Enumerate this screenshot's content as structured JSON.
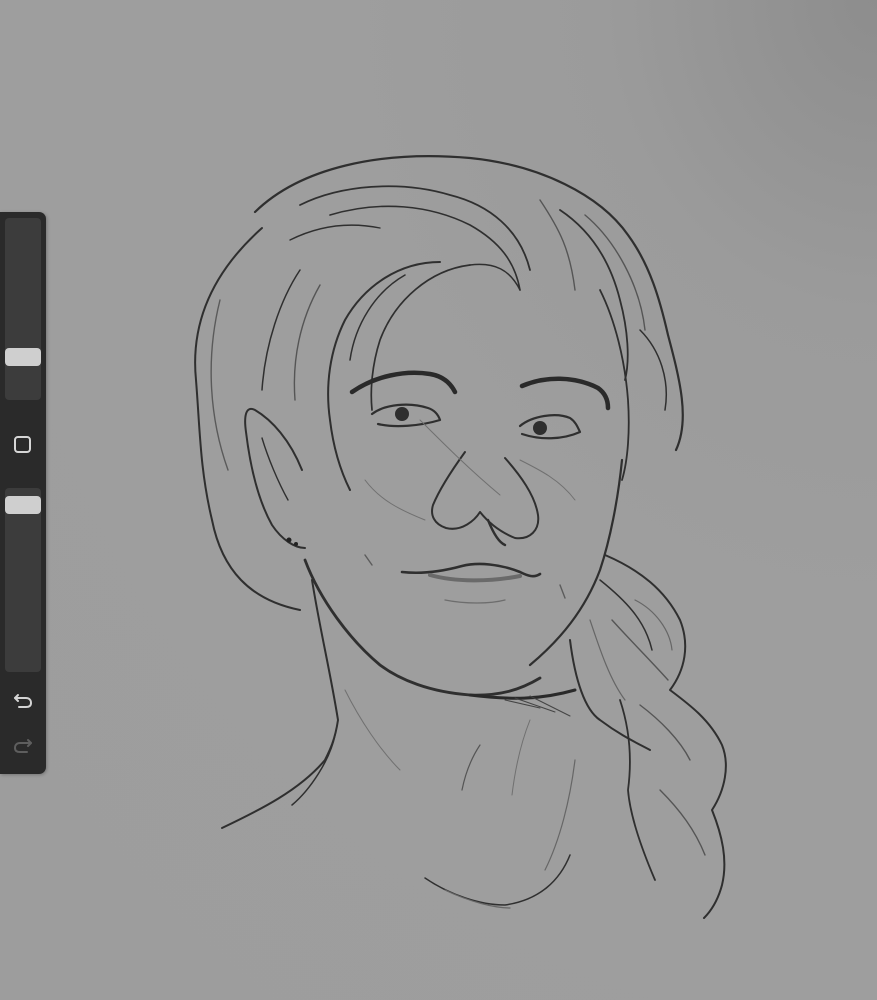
{
  "app": {
    "accent": "#cfcfcf",
    "panel_color": "#2a2a2a",
    "canvas_color": "#9d9d9d"
  },
  "sidebar": {
    "brush_size": {
      "icon": "slider-thumb",
      "level": 0.21
    },
    "modify_button": {
      "icon": "square-icon"
    },
    "brush_opacity": {
      "icon": "slider-thumb",
      "level": 0.95
    },
    "undo": {
      "icon": "undo-icon",
      "enabled": true
    },
    "redo": {
      "icon": "redo-icon",
      "enabled": false
    }
  },
  "canvas": {
    "artwork": "sketch-portrait",
    "stroke_color": "#2b2b2b"
  }
}
